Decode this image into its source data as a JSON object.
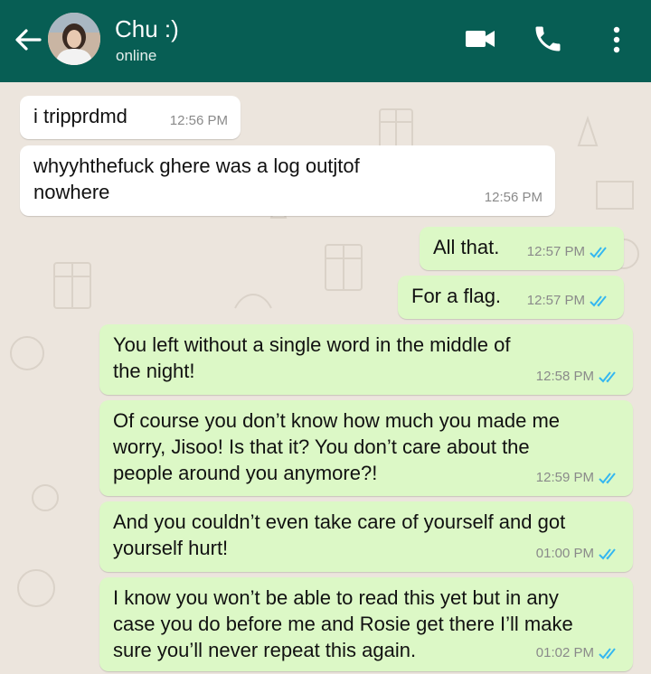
{
  "header": {
    "contact_name": "Chu :)",
    "status": "online",
    "colors": {
      "bar": "#075e54",
      "outgoing_bubble": "#dcf8c6",
      "incoming_bubble": "#ffffff",
      "read_ticks": "#34b7f1"
    },
    "icons": [
      "back-arrow-icon",
      "avatar",
      "video-call-icon",
      "phone-icon",
      "more-vert-icon"
    ]
  },
  "messages": [
    {
      "direction": "in",
      "text": "i tripprdmd",
      "time": "12:56 PM"
    },
    {
      "direction": "in",
      "text": "whyyhthefuck ghere was a log outjtof\nnowhere",
      "time": "12:56 PM"
    },
    {
      "direction": "out",
      "text": "All that.",
      "time": "12:57 PM",
      "status": "read"
    },
    {
      "direction": "out",
      "text": "For a flag.",
      "time": "12:57 PM",
      "status": "read"
    },
    {
      "direction": "out",
      "text": "You left without a single word in the middle of\nthe night!",
      "time": "12:58 PM",
      "status": "read"
    },
    {
      "direction": "out",
      "text": "Of course you don’t know how much you made me\nworry, Jisoo! Is that it? You don’t care about the\npeople around you anymore?!",
      "time": "12:59 PM",
      "status": "read"
    },
    {
      "direction": "out",
      "text": "And you couldn’t even take care of yourself and got\nyourself hurt!",
      "time": "01:00 PM",
      "status": "read"
    },
    {
      "direction": "out",
      "text": "I know you won’t be able to read this yet but in any\ncase you do before me and Rosie get there I’ll make\nsure you’ll never repeat this again.",
      "time": "01:02 PM",
      "status": "read"
    }
  ]
}
